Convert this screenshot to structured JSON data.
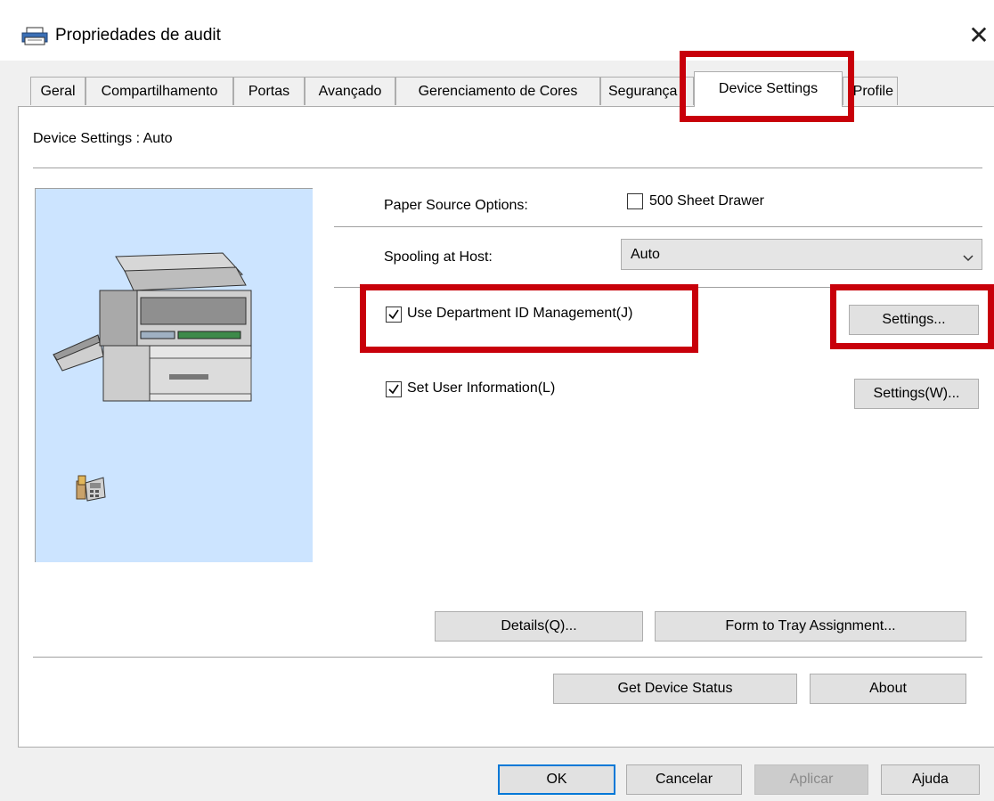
{
  "window": {
    "title": "Propriedades de audit",
    "close_symbol": "✕",
    "title_icon": "printer-icon"
  },
  "tabs": [
    {
      "label": "Geral"
    },
    {
      "label": "Compartilhamento"
    },
    {
      "label": "Portas"
    },
    {
      "label": "Avançado"
    },
    {
      "label": "Gerenciamento de Cores"
    },
    {
      "label": "Segurança"
    },
    {
      "label": "Device Settings",
      "active": true
    },
    {
      "label": "Profile"
    }
  ],
  "panel": {
    "heading": "Device Settings : Auto",
    "paper_source_label": "Paper Source Options:",
    "drawer_checkbox": {
      "label": "500 Sheet Drawer",
      "checked": false
    },
    "spooling_label": "Spooling at Host:",
    "spooling_select": {
      "value": "Auto"
    },
    "dept_id_checkbox": {
      "label": "Use Department ID Management(J)",
      "checked": true
    },
    "dept_settings_button": "Settings...",
    "user_info_checkbox": {
      "label": "Set User Information(L)",
      "checked": true
    },
    "user_settings_button": "Settings(W)...",
    "details_button": "Details(Q)...",
    "form_tray_button": "Form to Tray Assignment...",
    "get_status_button": "Get Device Status",
    "about_button": "About"
  },
  "footer": {
    "ok": "OK",
    "cancel": "Cancelar",
    "apply": "Aplicar",
    "help": "Ajuda"
  },
  "colors": {
    "highlight": "#c8000a",
    "image_pane": "#cce4ff",
    "default_button_border": "#0078d7"
  }
}
